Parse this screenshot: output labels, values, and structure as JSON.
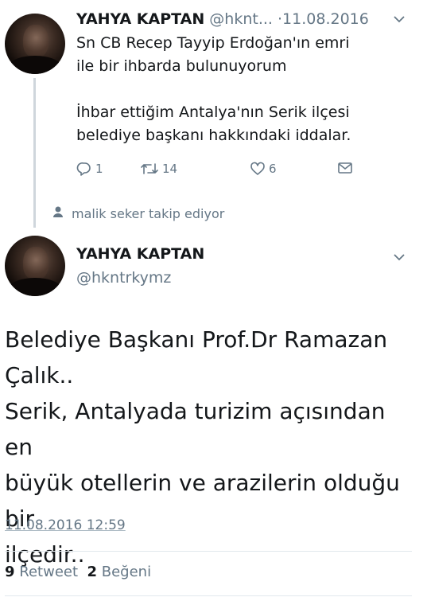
{
  "tweet1": {
    "name": "YAHYA KAPTAN",
    "handle": "@hknt...",
    "separator": "·",
    "date": "11.08.2016",
    "text": "Sn CB Recep Tayyip Erdoğan'ın emri\nile bir ihbarda bulunuyorum\n\nİhbar ettiğim Antalya'nın  Serik ilçesi\nbelediye başkanı hakkındaki iddalar.",
    "actions": {
      "reply_count": "1",
      "retweet_count": "14",
      "like_count": "6"
    }
  },
  "follow_notice": "malik seker takip ediyor",
  "tweet2": {
    "name": "YAHYA KAPTAN",
    "handle": "@hkntrkymz",
    "text": "Belediye Başkanı Prof.Dr Ramazan\nÇalık..\nSerik, Antalyada turizim açısından en\nbüyük otellerin ve arazilerin olduğu bir\nilçedir..",
    "timestamp": "11.08.2016 12:59",
    "retweets_count": "9",
    "retweets_label": "Retweet",
    "likes_count": "2",
    "likes_label": "Beğeni"
  },
  "icons": {
    "reply": "reply-icon",
    "retweet": "retweet-icon",
    "like": "heart-icon",
    "dm": "envelope-icon",
    "follow": "person-icon",
    "caret": "chevron-down-icon"
  },
  "colors": {
    "text": "#14171a",
    "secondary": "#657786",
    "thread_line": "#cfd6dc",
    "divider": "#e1e8ed"
  }
}
